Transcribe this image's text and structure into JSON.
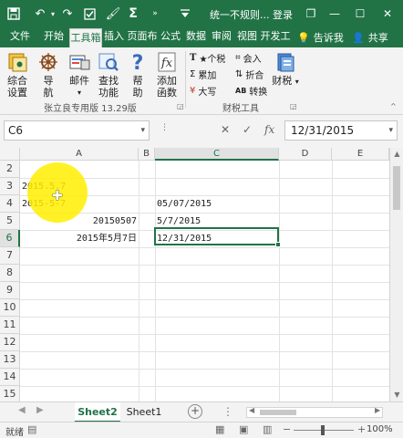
{
  "titlebar": {
    "title": "统一不规则...   登录",
    "quick_access": [
      "save-icon",
      "undo-icon",
      "redo-icon",
      "checkbox-icon",
      "brush-icon",
      "sigma-icon",
      "more-icon"
    ],
    "window": {
      "restore": "❐",
      "minimize": "—",
      "maximize": "☐",
      "close": "✕"
    }
  },
  "ribbon_tabs": [
    "文件",
    "开始",
    "工具箱",
    "插入",
    "页面布",
    "公式",
    "数据",
    "审阅",
    "视图",
    "开发工"
  ],
  "active_tab": "工具箱",
  "tell_me": "告诉我",
  "share": "共享",
  "ribbon": {
    "group1_buttons": [
      {
        "label": "综合\n设置"
      },
      {
        "label": "导\n航"
      },
      {
        "label": "邮件"
      },
      {
        "label": "查找\n功能"
      },
      {
        "label": "帮\n助"
      },
      {
        "label": "添加\n函数"
      }
    ],
    "group1_label": "张立良专用版 13.29版",
    "group2_small": [
      {
        "label": "★个税",
        "icon": "T"
      },
      {
        "label": "会入",
        "icon": "⌗"
      },
      {
        "label": "累加",
        "icon": "Σ"
      },
      {
        "label": "折合",
        "icon": "⇅"
      },
      {
        "label": "大写",
        "icon": "¥"
      },
      {
        "label": "转换",
        "icon": "AB"
      }
    ],
    "group2_big": "财税",
    "group2_label": "财税工具"
  },
  "formula_bar": {
    "name_box": "C6",
    "formula": "12/31/2015"
  },
  "grid": {
    "columns": [
      "A",
      "B",
      "C",
      "D",
      "E"
    ],
    "selected_column": "C",
    "rows": [
      "2",
      "3",
      "4",
      "5",
      "6",
      "7",
      "8",
      "9",
      "10",
      "11",
      "12",
      "13",
      "14",
      "15"
    ],
    "selected_row": "6",
    "cells": {
      "a3": "2015.5.7",
      "a4": "2015-5-7",
      "c4": "05/07/2015",
      "a5": "20150507",
      "c5": "5/7/2015",
      "a6": "2015年5月7日",
      "c6": "12/31/2015"
    }
  },
  "sheets": [
    "Sheet2",
    "Sheet1"
  ],
  "active_sheet": "Sheet2",
  "status": {
    "mode": "就绪",
    "zoom": "100%"
  },
  "colors": {
    "accent": "#217346",
    "highlight": "#ffee00"
  }
}
